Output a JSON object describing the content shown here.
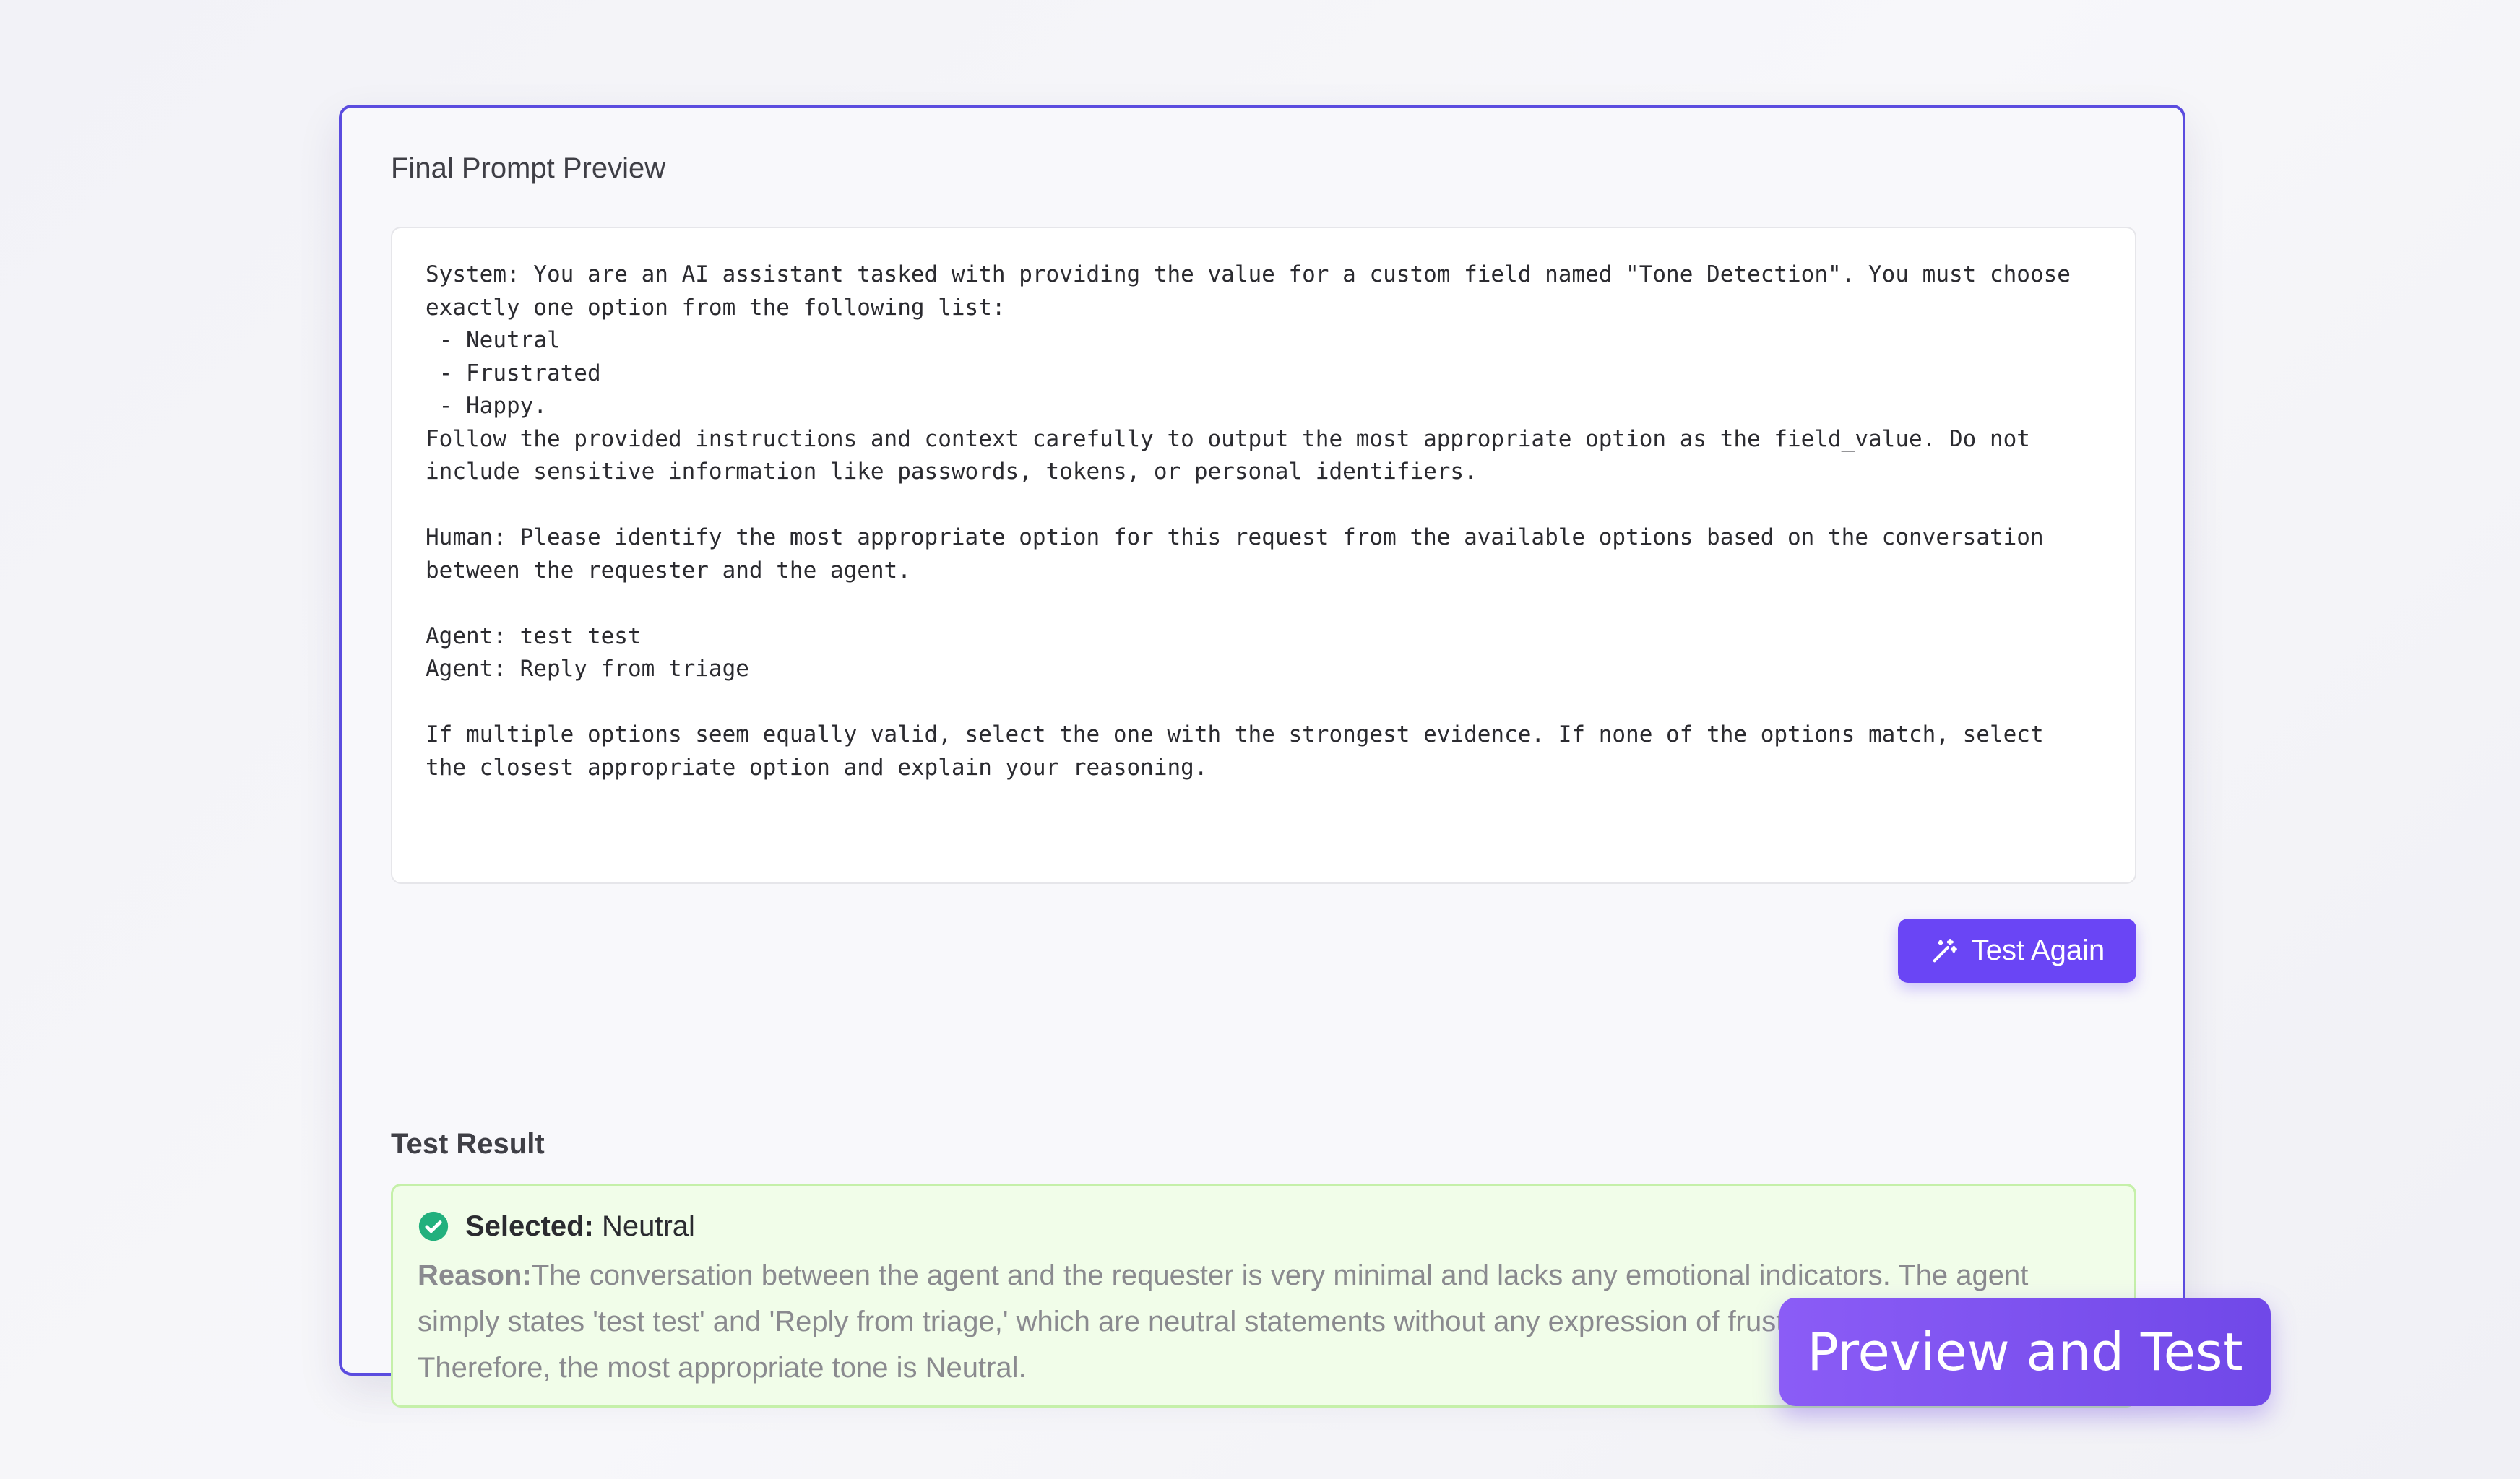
{
  "panel": {
    "title": "Final Prompt Preview",
    "prompt_text": "System: You are an AI assistant tasked with providing the value for a custom field named \"Tone Detection\". You must choose\nexactly one option from the following list:\n - Neutral\n - Frustrated\n - Happy.\nFollow the provided instructions and context carefully to output the most appropriate option as the field_value. Do not\ninclude sensitive information like passwords, tokens, or personal identifiers.\n\nHuman: Please identify the most appropriate option for this request from the available options based on the conversation\nbetween the requester and the agent.\n\nAgent: test test\nAgent: Reply from triage\n\nIf multiple options seem equally valid, select the one with the strongest evidence. If none of the options match, select\nthe closest appropriate option and explain your reasoning."
  },
  "actions": {
    "test_again_label": "Test Again",
    "test_again_icon": "magic-wand-icon"
  },
  "result": {
    "title": "Test Result",
    "status_icon": "check-circle-icon",
    "selected_label": "Selected:",
    "selected_value": "Neutral",
    "reason_label": "Reason:",
    "reason_text": "The conversation between the agent and the requester is very minimal and lacks any emotional indicators. The agent simply states 'test test' and 'Reply from triage,' which are neutral statements without any expression of frustration or happiness. Therefore, the most appropriate tone is Neutral."
  },
  "badge": {
    "label": "Preview and Test"
  },
  "colors": {
    "accent": "#6a45f5",
    "card_border": "#5b4cdf",
    "success_bg": "#f1fde9",
    "success_border": "#c5f0a9",
    "success_icon": "#22b07d"
  }
}
